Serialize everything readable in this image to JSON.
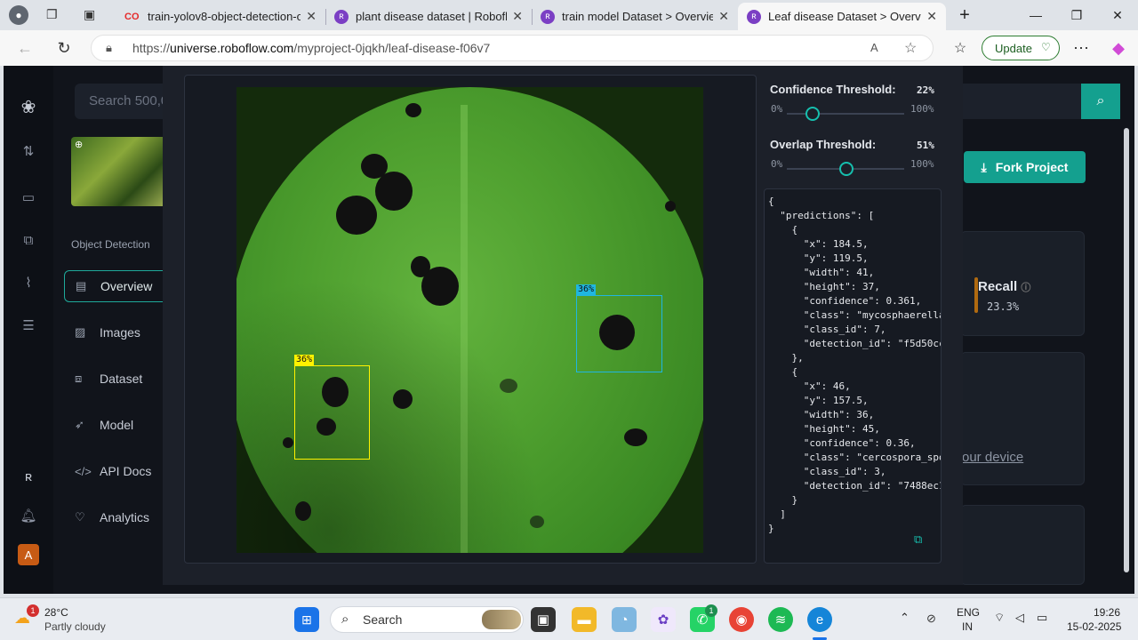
{
  "browser": {
    "tabs": [
      {
        "title": "train-yolov8-object-detection-o",
        "icon": "colab-icon",
        "active": false
      },
      {
        "title": "plant disease dataset | Roboflow",
        "icon": "roboflow-icon",
        "active": false
      },
      {
        "title": "train model Dataset > Overview",
        "icon": "roboflow-icon",
        "active": false
      },
      {
        "title": "Leaf disease Dataset > Overview",
        "icon": "roboflow-icon",
        "active": true
      }
    ],
    "url_prefix": "https://",
    "url_domain": "universe.roboflow.com",
    "url_path": "/myproject-0jqkh/leaf-disease-f06v7",
    "update_label": "Update"
  },
  "sidebar": {
    "search_placeholder": "Search 500,0",
    "section_label": "Object Detection",
    "items": [
      {
        "label": "Overview",
        "icon": "overview-icon",
        "active": true
      },
      {
        "label": "Images",
        "icon": "images-icon"
      },
      {
        "label": "Dataset",
        "icon": "dataset-icon"
      },
      {
        "label": "Model",
        "icon": "model-icon"
      },
      {
        "label": "API Docs",
        "icon": "code-icon"
      },
      {
        "label": "Analytics",
        "icon": "analytics-icon"
      }
    ],
    "avatar_letter": "A"
  },
  "background": {
    "fork_label": "Fork Project",
    "recall_label": "Recall",
    "recall_value": "23.3%",
    "device_partial_1": "l",
    "device_partial_2": "our device"
  },
  "modal": {
    "confidence": {
      "label": "Confidence Threshold:",
      "value": "22%",
      "value_frac": 0.22,
      "min": "0%",
      "max": "100%"
    },
    "overlap": {
      "label": "Overlap Threshold:",
      "value": "51%",
      "value_frac": 0.51,
      "min": "0%",
      "max": "100%"
    },
    "detections": [
      {
        "label": "36%",
        "color": "#fff200"
      },
      {
        "label": "36%",
        "color": "#1fb6e0"
      }
    ],
    "json_text": "{\n  \"predictions\": [\n    {\n      \"x\": 184.5,\n      \"y\": 119.5,\n      \"width\": 41,\n      \"height\": 37,\n      \"confidence\": 0.361,\n      \"class\": \"mycosphaerella\n      \"class_id\": 7,\n      \"detection_id\": \"f5d50cc\n    },\n    {\n      \"x\": 46,\n      \"y\": 157.5,\n      \"width\": 36,\n      \"height\": 45,\n      \"confidence\": 0.36,\n      \"class\": \"cercospora_spo\n      \"class_id\": 3,\n      \"detection_id\": \"7488ec1\n    }\n  ]\n}"
  },
  "taskbar": {
    "weather_temp": "28°C",
    "weather_desc": "Partly cloudy",
    "weather_badge": "1",
    "search_label": "Search",
    "whatsapp_badge": "1",
    "lang_1": "ENG",
    "lang_2": "IN",
    "time": "19:26",
    "date": "15-02-2025"
  },
  "colors": {
    "accent": "#14a08f",
    "page_bg": "#11141b",
    "modal_bg": "#1c2029"
  }
}
